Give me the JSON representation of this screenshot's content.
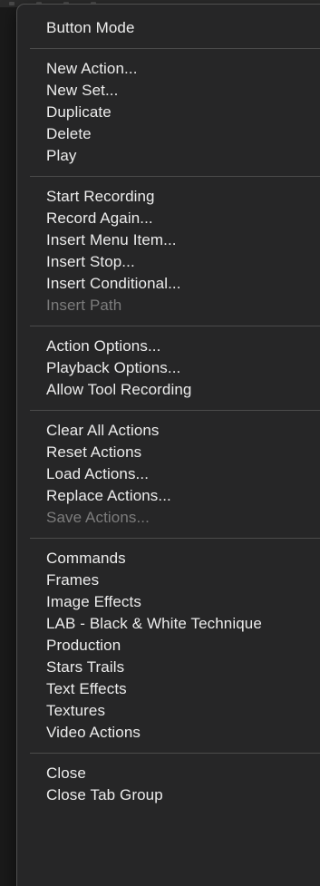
{
  "menu": {
    "groups": [
      [
        {
          "label": "Button Mode",
          "enabled": true
        }
      ],
      [
        {
          "label": "New Action...",
          "enabled": true
        },
        {
          "label": "New Set...",
          "enabled": true
        },
        {
          "label": "Duplicate",
          "enabled": true
        },
        {
          "label": "Delete",
          "enabled": true
        },
        {
          "label": "Play",
          "enabled": true
        }
      ],
      [
        {
          "label": "Start Recording",
          "enabled": true
        },
        {
          "label": "Record Again...",
          "enabled": true
        },
        {
          "label": "Insert Menu Item...",
          "enabled": true
        },
        {
          "label": "Insert Stop...",
          "enabled": true
        },
        {
          "label": "Insert Conditional...",
          "enabled": true
        },
        {
          "label": "Insert Path",
          "enabled": false
        }
      ],
      [
        {
          "label": "Action Options...",
          "enabled": true
        },
        {
          "label": "Playback Options...",
          "enabled": true
        },
        {
          "label": "Allow Tool Recording",
          "enabled": true
        }
      ],
      [
        {
          "label": "Clear All Actions",
          "enabled": true
        },
        {
          "label": "Reset Actions",
          "enabled": true
        },
        {
          "label": "Load Actions...",
          "enabled": true
        },
        {
          "label": "Replace Actions...",
          "enabled": true
        },
        {
          "label": "Save Actions...",
          "enabled": false
        }
      ],
      [
        {
          "label": "Commands",
          "enabled": true
        },
        {
          "label": "Frames",
          "enabled": true
        },
        {
          "label": "Image Effects",
          "enabled": true
        },
        {
          "label": "LAB - Black & White Technique",
          "enabled": true
        },
        {
          "label": "Production",
          "enabled": true
        },
        {
          "label": "Stars Trails",
          "enabled": true
        },
        {
          "label": "Text Effects",
          "enabled": true
        },
        {
          "label": "Textures",
          "enabled": true
        },
        {
          "label": "Video Actions",
          "enabled": true
        }
      ],
      [
        {
          "label": "Close",
          "enabled": true
        },
        {
          "label": "Close Tab Group",
          "enabled": true
        }
      ]
    ]
  },
  "colors": {
    "menu_background": "#262627",
    "text_enabled": "#ececec",
    "text_disabled": "#7c7c7c",
    "separator": "#4b4b4b"
  }
}
